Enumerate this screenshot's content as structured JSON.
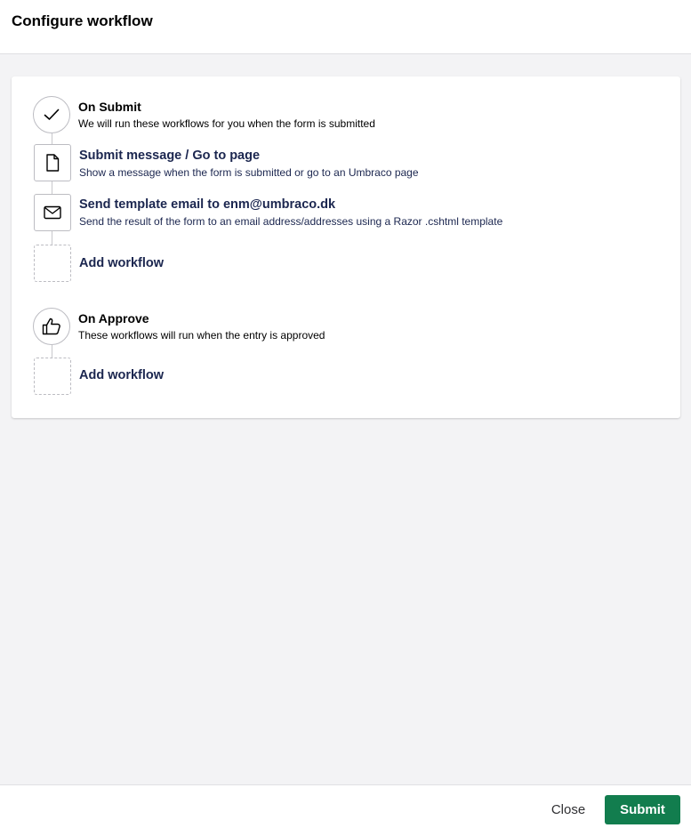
{
  "header": {
    "title": "Configure workflow"
  },
  "on_submit": {
    "title": "On Submit",
    "description": "We will run these workflows for you when the form is submitted",
    "icon": "check-icon",
    "workflows": [
      {
        "title": "Submit message / Go to page",
        "description": "Show a message when the form is submitted or go to an Umbraco page",
        "icon": "document-icon"
      },
      {
        "title": "Send template email to enm@umbraco.dk",
        "description": "Send the result of the form to an email address/addresses using a Razor .cshtml template",
        "icon": "envelope-icon"
      }
    ],
    "add_label": "Add workflow"
  },
  "on_approve": {
    "title": "On Approve",
    "description": "These workflows will run when the entry is approved",
    "icon": "thumbs-up-icon",
    "add_label": "Add workflow"
  },
  "footer": {
    "close_label": "Close",
    "submit_label": "Submit"
  },
  "colors": {
    "submit_button": "#127d4e",
    "text_primary": "#1b264f",
    "background": "#f3f3f5"
  }
}
